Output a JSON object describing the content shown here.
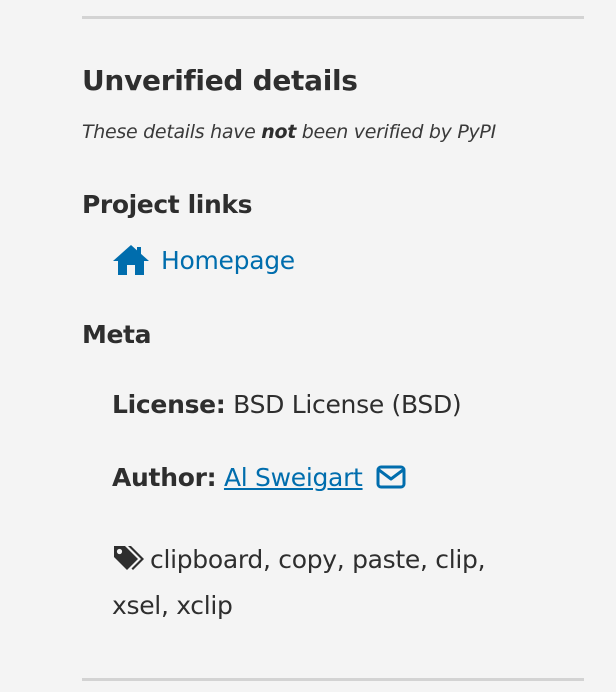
{
  "sidebar": {
    "section_title": "Unverified details",
    "note_prefix": "These details have ",
    "note_emphasis": "not",
    "note_suffix": " been verified by PyPI",
    "project_links": {
      "title": "Project links",
      "homepage_label": "Homepage",
      "homepage_icon": "home-icon"
    },
    "meta": {
      "title": "Meta",
      "license_label": "License:",
      "license_value": "BSD License (BSD)",
      "author_label": "Author:",
      "author_name": "Al Sweigart",
      "author_mail_icon": "envelope-icon",
      "keywords_icon": "tags-icon",
      "keywords_line1": "clipboard, copy, paste, clip,",
      "keywords_line2": "xsel, xclip"
    }
  },
  "colors": {
    "background": "#f4f4f4",
    "text": "#2e2e2e",
    "link": "#006dad",
    "divider": "#d3d3d3"
  }
}
